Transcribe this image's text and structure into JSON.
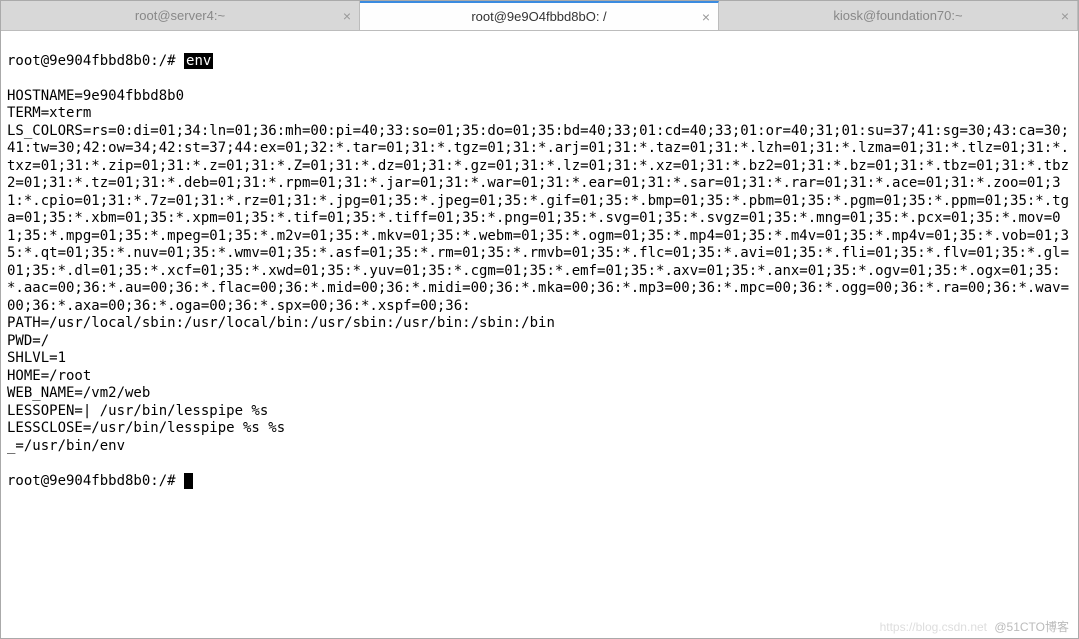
{
  "tabs": [
    {
      "label": "root@server4:~",
      "active": false
    },
    {
      "label": "root@9e9O4fbbd8bO: /",
      "active": true
    },
    {
      "label": "kiosk@foundation70:~",
      "active": false
    }
  ],
  "terminal": {
    "prompt1": "root@9e904fbbd8b0:/# ",
    "cmd": "env",
    "envblock": "HOSTNAME=9e904fbbd8b0\nTERM=xterm\nLS_COLORS=rs=0:di=01;34:ln=01;36:mh=00:pi=40;33:so=01;35:do=01;35:bd=40;33;01:cd=40;33;01:or=40;31;01:su=37;41:sg=30;43:ca=30;41:tw=30;42:ow=34;42:st=37;44:ex=01;32:*.tar=01;31:*.tgz=01;31:*.arj=01;31:*.taz=01;31:*.lzh=01;31:*.lzma=01;31:*.tlz=01;31:*.txz=01;31:*.zip=01;31:*.z=01;31:*.Z=01;31:*.dz=01;31:*.gz=01;31:*.lz=01;31:*.xz=01;31:*.bz2=01;31:*.bz=01;31:*.tbz=01;31:*.tbz2=01;31:*.tz=01;31:*.deb=01;31:*.rpm=01;31:*.jar=01;31:*.war=01;31:*.ear=01;31:*.sar=01;31:*.rar=01;31:*.ace=01;31:*.zoo=01;31:*.cpio=01;31:*.7z=01;31:*.rz=01;31:*.jpg=01;35:*.jpeg=01;35:*.gif=01;35:*.bmp=01;35:*.pbm=01;35:*.pgm=01;35:*.ppm=01;35:*.tga=01;35:*.xbm=01;35:*.xpm=01;35:*.tif=01;35:*.tiff=01;35:*.png=01;35:*.svg=01;35:*.svgz=01;35:*.mng=01;35:*.pcx=01;35:*.mov=01;35:*.mpg=01;35:*.mpeg=01;35:*.m2v=01;35:*.mkv=01;35:*.webm=01;35:*.ogm=01;35:*.mp4=01;35:*.m4v=01;35:*.mp4v=01;35:*.vob=01;35:*.qt=01;35:*.nuv=01;35:*.wmv=01;35:*.asf=01;35:*.rm=01;35:*.rmvb=01;35:*.flc=01;35:*.avi=01;35:*.fli=01;35:*.flv=01;35:*.gl=01;35:*.dl=01;35:*.xcf=01;35:*.xwd=01;35:*.yuv=01;35:*.cgm=01;35:*.emf=01;35:*.axv=01;35:*.anx=01;35:*.ogv=01;35:*.ogx=01;35:*.aac=00;36:*.au=00;36:*.flac=00;36:*.mid=00;36:*.midi=00;36:*.mka=00;36:*.mp3=00;36:*.mpc=00;36:*.ogg=00;36:*.ra=00;36:*.wav=00;36:*.axa=00;36:*.oga=00;36:*.spx=00;36:*.xspf=00;36:\nPATH=/usr/local/sbin:/usr/local/bin:/usr/sbin:/usr/bin:/sbin:/bin\nPWD=/\nSHLVL=1\nHOME=/root\nWEB_NAME=/vm2/web\nLESSOPEN=| /usr/bin/lesspipe %s\nLESSCLOSE=/usr/bin/lesspipe %s %s\n_=/usr/bin/env",
    "prompt2": "root@9e904fbbd8b0:/# "
  },
  "watermark": {
    "left": "https://blog.csdn.net",
    "right": "@51CTO博客"
  }
}
